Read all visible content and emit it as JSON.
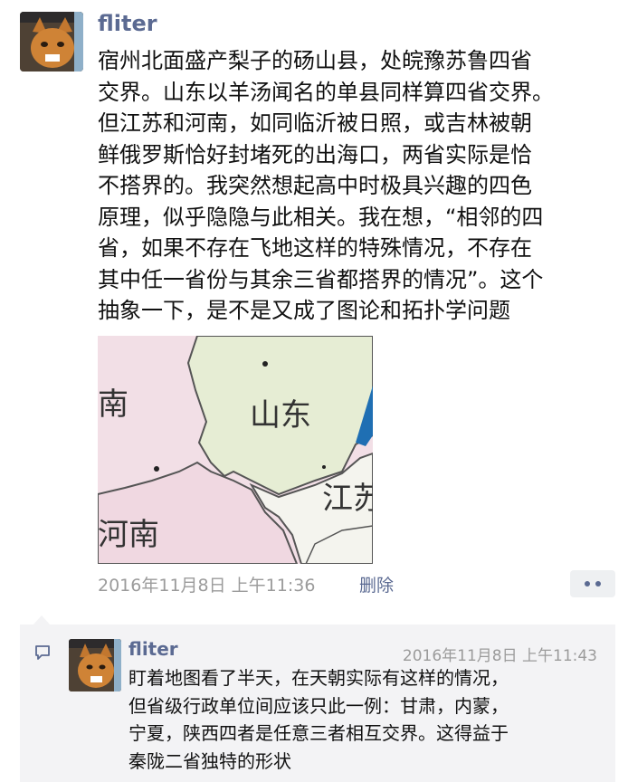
{
  "post": {
    "author": "fliter",
    "text": "宿州北面盛产梨子的砀山县，处皖豫苏鲁四省\n交界。山东以羊汤闻名的单县同样算四省交界。\n但江苏和河南，如同临沂被日照，或吉林被朝\n鲜俄罗斯恰好封堵死的出海口，两省实际是恰\n不搭界的。我突然想起高中时极具兴趣的四色\n原理，似乎隐隐与此相关。我在想，“相邻的四\n省，如果不存在飞地这样的特殊情况，不存在\n其中任一省份与其余三省都搭界的情况”。这个\n抽象一下，是不是又成了图论和拓扑学问题",
    "image": {
      "labels": {
        "top_left": "南",
        "shandong": "山东",
        "jiangsu": "江苏",
        "henan": "河南"
      }
    },
    "timestamp": "2016年11月8日 上午11:36",
    "delete_label": "删除"
  },
  "comment": {
    "author": "fliter",
    "timestamp": "2016年11月8日 上午11:43",
    "text": "盯着地图看了半天，在天朝实际有这样的情况，\n但省级行政单位间应该只此一例：甘肃，内蒙，\n宁夏，陕西四者是任意三者相互交界。这得益于\n秦陇二省独特的形状"
  },
  "colors": {
    "name_link": "#5b6a92",
    "meta_gray": "#9b9b9b",
    "comment_bg": "#f3f3f5"
  }
}
